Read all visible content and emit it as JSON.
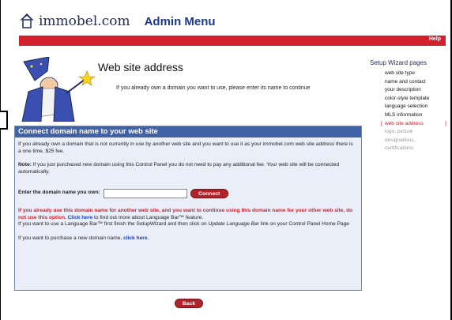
{
  "header": {
    "logo_text": "immobel.com",
    "admin_title": "Admin Menu",
    "help_label": "Help"
  },
  "page": {
    "title": "Web site address",
    "subtitle": "If you already own a domain you want to use, please enter its name to continue"
  },
  "sidebar": {
    "title": "Setup Wizard pages",
    "items": [
      {
        "label": "web site type",
        "state": "done"
      },
      {
        "label": "name and contact",
        "state": "done"
      },
      {
        "label": "your description",
        "state": "done"
      },
      {
        "label": "color-style template",
        "state": "done"
      },
      {
        "label": "language selection",
        "state": "done"
      },
      {
        "label": "MLS information",
        "state": "done"
      },
      {
        "label": "web site address",
        "state": "active"
      },
      {
        "label": "logo, picture",
        "state": "pending"
      },
      {
        "label": "designations,",
        "state": "pending"
      },
      {
        "label": "certifications",
        "state": "pending"
      }
    ]
  },
  "panel": {
    "header": "Connect domain name to your web site",
    "intro": "If you already own a domain that is not currently in use by another web site and you want to use it as your immobel.com web site address there is a one time, $25 fee.",
    "note_label": "Note:",
    "note_text": " If you just purchased new domain using this Control Panel you do not need to pay any additional fee. Your web site will be connected automatically.",
    "domain_label": "Enter the domain name you own:",
    "domain_value": "",
    "connect_label": "Connect",
    "warning_text": "If you already use this domain name for another web site, and you want to continue using this domain name for your other web site, do not use this option.",
    "warning_link": "Click here",
    "warning_suffix": " to find out more about Language Bar™ feature.",
    "langbar_text": "If you want to use a Language Bar™ first finish the SetupWizard and then click on ",
    "langbar_italic": "Update Language Bar",
    "langbar_suffix": " link on your Control Panel Home Page",
    "purchase_text": "If you want to purchase a new domain name, ",
    "purchase_link": "click here",
    "purchase_suffix": "."
  },
  "footer": {
    "back_label": "Back"
  },
  "colors": {
    "brand_red": "#d3202d",
    "panel_header": "#4163a6",
    "panel_bg": "#e9eef8",
    "link": "#1a3fb4"
  }
}
